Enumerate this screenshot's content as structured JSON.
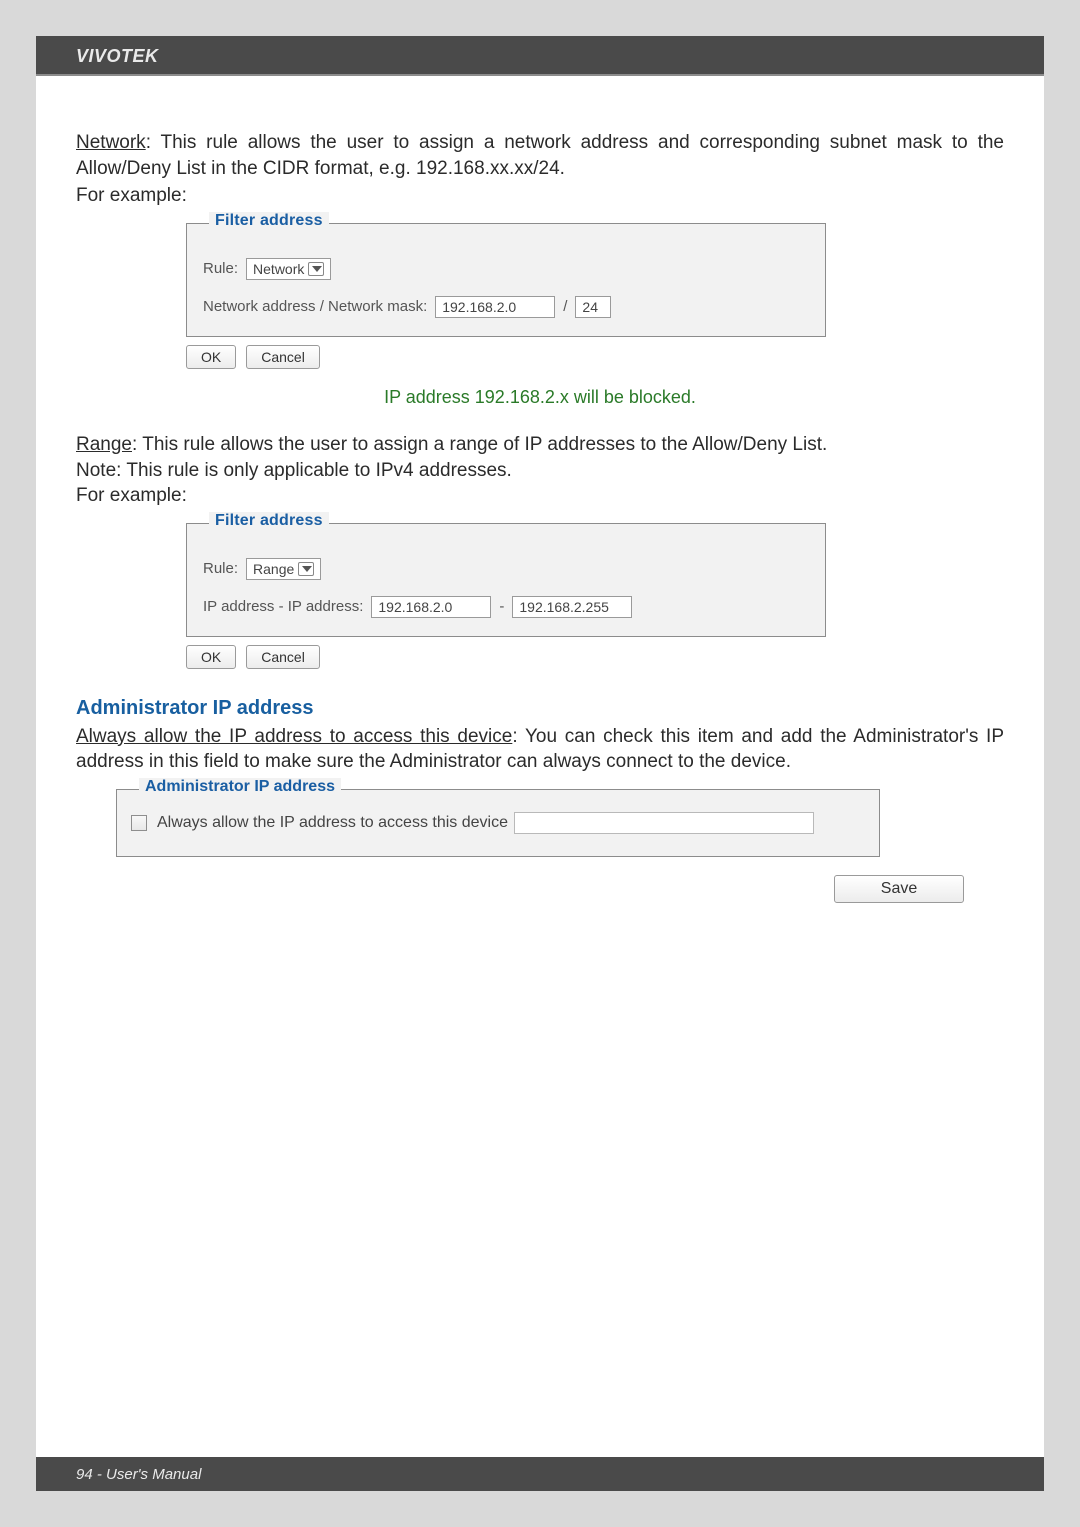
{
  "header": {
    "brand": "VIVOTEK"
  },
  "sections": {
    "network": {
      "heading": "Network",
      "desc": ": This rule allows the user to assign a network address and corresponding subnet mask to the Allow/Deny List in the CIDR format, e.g. 192.168.xx.xx/24.",
      "example_label": "For example:",
      "caption": "IP address 192.168.2.x will be blocked."
    },
    "range": {
      "heading": "Range",
      "desc": ": This rule allows the user to assign a range of IP addresses to the Allow/Deny List.",
      "note": "Note: This rule is only applicable to IPv4 addresses.",
      "example_label": "For example:"
    },
    "admin": {
      "heading": "Administrator IP address",
      "always_label": "Always allow the IP address to access this device",
      "desc": ": You can check this item and add the Administrator's IP address in this field to make sure the Administrator can always connect to the device."
    }
  },
  "panels": {
    "filter_network": {
      "legend": "Filter address",
      "rule_label": "Rule:",
      "rule_value": "Network",
      "netaddr_label": "Network address / Network mask:",
      "addr_value": "192.168.2.0",
      "separator": "/",
      "mask_value": "24"
    },
    "filter_range": {
      "legend": "Filter address",
      "rule_label": "Rule:",
      "rule_value": "Range",
      "ip_label": "IP address - IP address:",
      "ip_from": "192.168.2.0",
      "separator": "-",
      "ip_to": "192.168.2.255"
    },
    "admin": {
      "legend": "Administrator IP address",
      "checkbox_label": "Always allow the IP address to access this device"
    }
  },
  "buttons": {
    "ok": "OK",
    "cancel": "Cancel",
    "save": "Save"
  },
  "footer": {
    "text": "94 - User's Manual"
  }
}
